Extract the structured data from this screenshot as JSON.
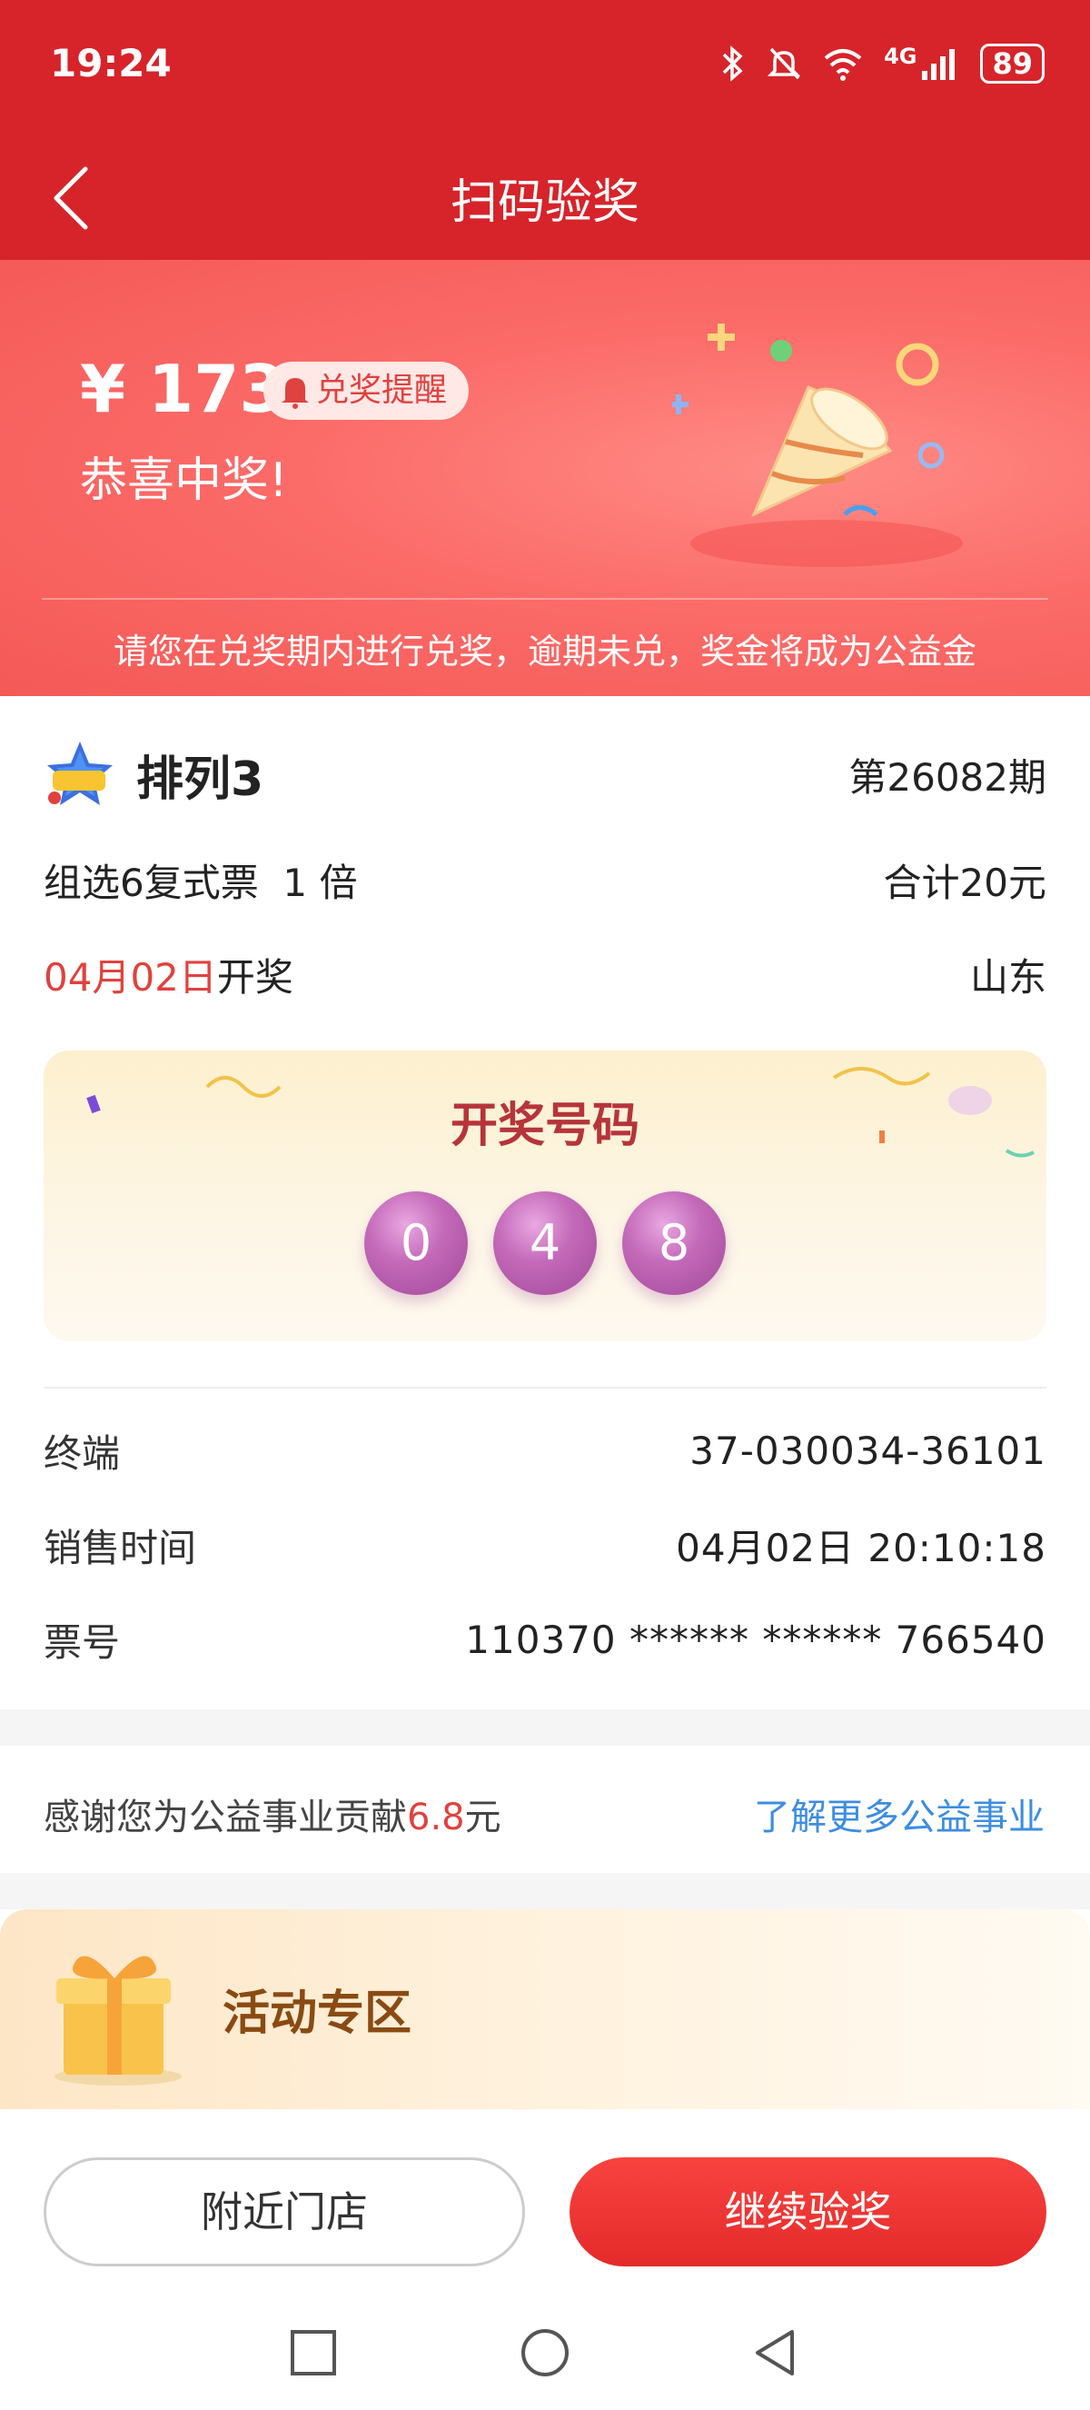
{
  "status_bar": {
    "time": "19:24",
    "battery": "89",
    "network": "4G",
    "icons": [
      "bluetooth-icon",
      "mute-icon",
      "wifi-icon",
      "signal-icon",
      "battery-icon"
    ]
  },
  "header": {
    "title": "扫码验奖",
    "back_icon": "chevron-left-icon"
  },
  "prize": {
    "amount": "¥ 173",
    "remind_label": "兑奖提醒",
    "congrats": "恭喜中奖!",
    "notice": "请您在兑奖期内进行兑奖，逾期未兑，奖金将成为公益金"
  },
  "ticket": {
    "lottery_name": "排列3",
    "issue": "第26082期",
    "play_type": "组选6复式票  1 倍",
    "total": "合计20元",
    "draw_date": "04月02日",
    "draw_suffix": "开奖",
    "region": "山东",
    "draw_title": "开奖号码",
    "numbers": [
      "0",
      "4",
      "8"
    ],
    "terminal_label": "终端",
    "terminal_value": "37-030034-36101",
    "sale_time_label": "销售时间",
    "sale_time_value": "04月02日 20:10:18",
    "ticket_no_label": "票号",
    "ticket_no_value": "110370 ****** ****** 766540"
  },
  "charity": {
    "text_prefix": "感谢您为公益事业贡献",
    "amount": "6.8",
    "text_suffix": "元",
    "link": "了解更多公益事业"
  },
  "activity": {
    "title": "活动专区"
  },
  "buttons": {
    "nearby": "附近门店",
    "continue": "继续验奖"
  },
  "colors": {
    "header_red": "#d6242a",
    "banner_red": "#f45956",
    "accent_red": "#e0423f",
    "ball_purple": "#b65bab",
    "link_blue": "#3d8de0",
    "activity_brown": "#8a4a12"
  }
}
